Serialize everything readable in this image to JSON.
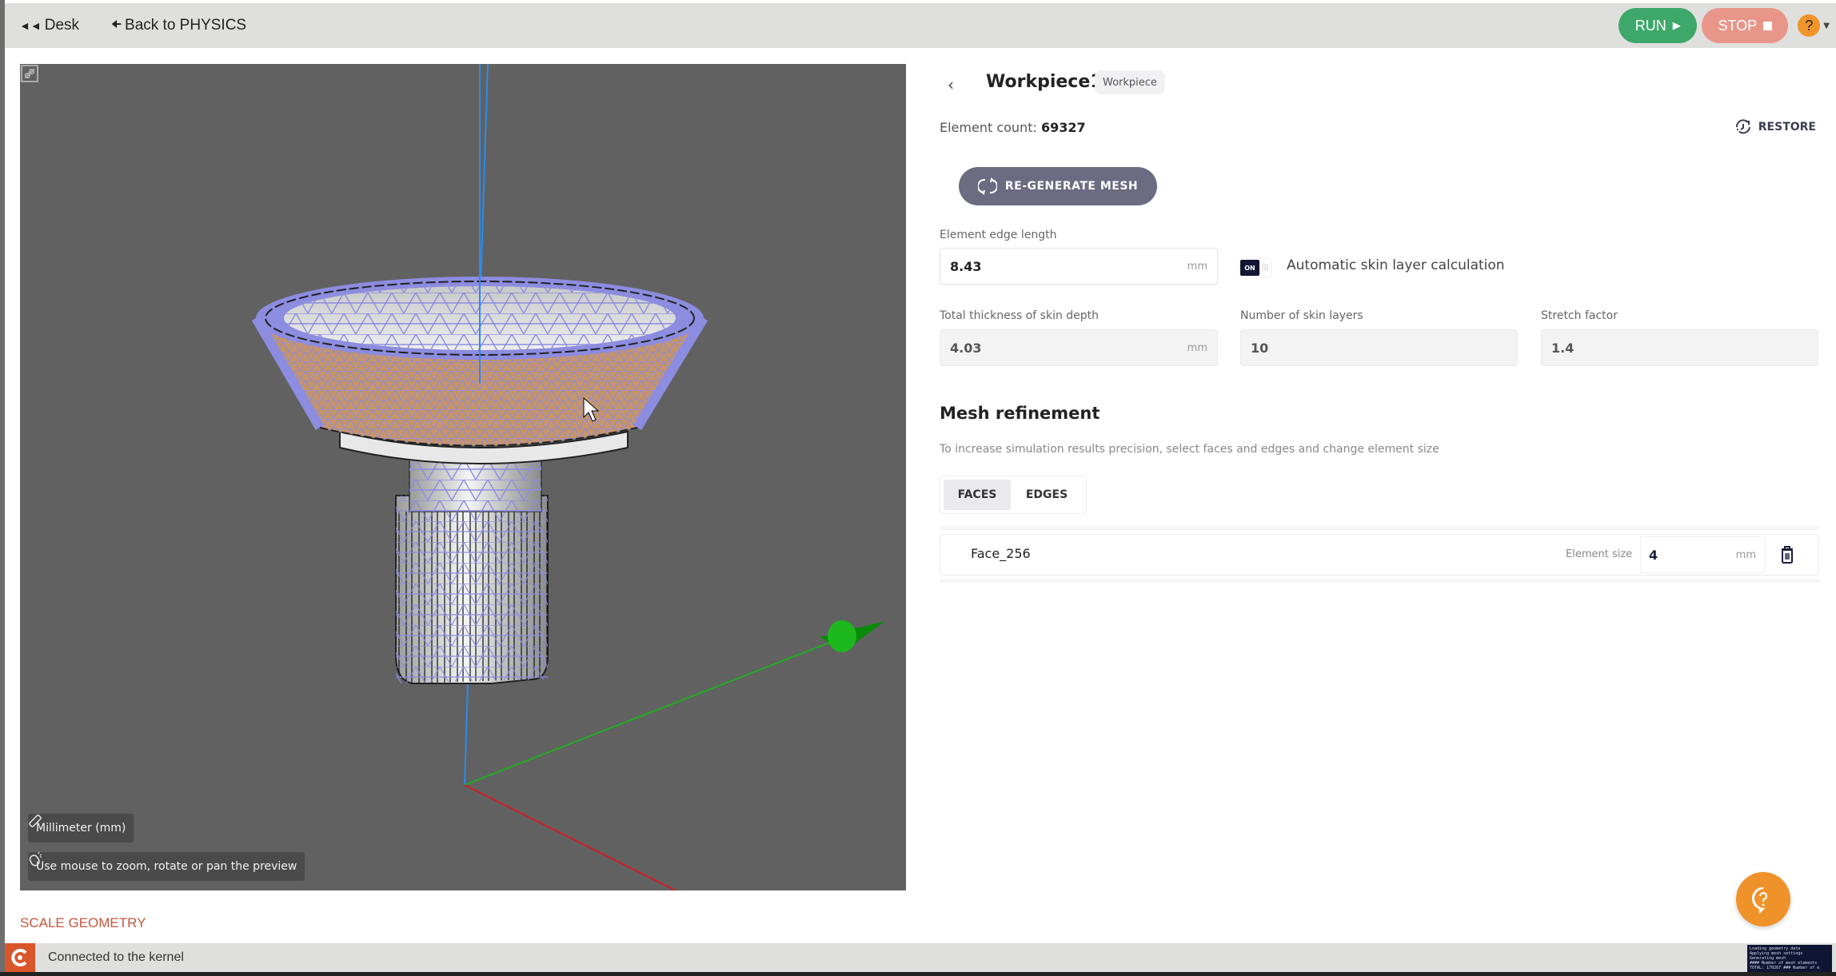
{
  "topbar": {
    "desk_label": "Desk",
    "back_label": "Back to PHYSICS",
    "run_label": "RUN",
    "stop_label": "STOP",
    "help_glyph": "?",
    "colors": {
      "run": "#3ea86a",
      "stop": "#e8968a",
      "help": "#f0952a"
    }
  },
  "viewport": {
    "unit_chip": "Millimeter (mm)",
    "hint_chip": "Use mouse to zoom, rotate or pan the preview",
    "background": "#616161",
    "axes": {
      "x_color": "#d01f1f",
      "y_color": "#1fae1f",
      "z_color": "#2a8cf0"
    },
    "mesh_color": "#8c8ce0",
    "selected_face_color": "#c8956a"
  },
  "scale_geometry_label": "SCALE GEOMETRY",
  "status": {
    "text": "Connected to the kernel",
    "console_lines": [
      "Loading geometry data",
      "Applying mesh settings",
      "Generating mesh",
      "#### Number of mesh elements",
      "TOTAL: 170267 ### Number of e"
    ]
  },
  "panel": {
    "title": "Workpiece1",
    "badge": "Workpiece",
    "element_count_label": "Element count:",
    "element_count": "69327",
    "restore_label": "RESTORE",
    "regenerate_label": "RE-GENERATE MESH",
    "edge_length": {
      "label": "Element edge length",
      "value": "8.43",
      "unit": "mm"
    },
    "auto_skin": {
      "state": "ON",
      "label": "Automatic skin layer calculation"
    },
    "skin_depth": {
      "label": "Total thickness of skin depth",
      "value": "4.03",
      "unit": "mm"
    },
    "skin_layers": {
      "label": "Number of skin layers",
      "value": "10"
    },
    "stretch": {
      "label": "Stretch factor",
      "value": "1.4"
    },
    "refinement": {
      "title": "Mesh refinement",
      "description": "To increase simulation results precision, select faces and edges and change element size",
      "tabs": [
        {
          "label": "FACES",
          "active": true
        },
        {
          "label": "EDGES",
          "active": false
        }
      ],
      "items": [
        {
          "name": "Face_256",
          "size_label": "Element size",
          "size": "4",
          "unit": "mm"
        }
      ]
    }
  }
}
